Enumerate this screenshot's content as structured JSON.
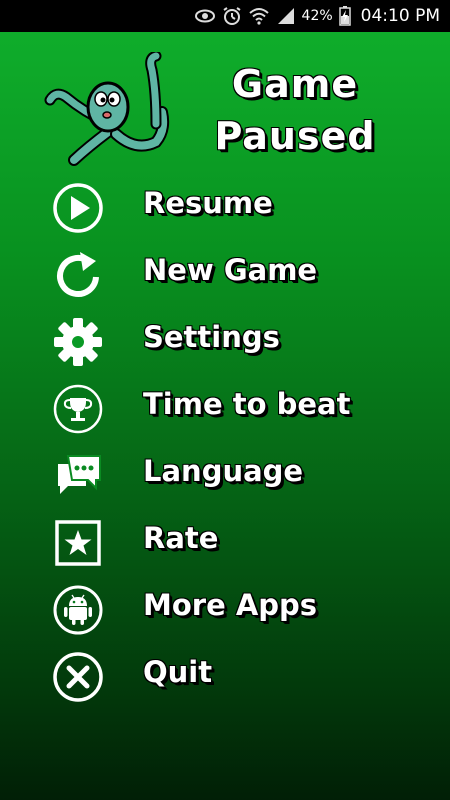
{
  "status_bar": {
    "battery_percent": "42%",
    "time": "04:10 PM",
    "icons": [
      "eye-icon",
      "alarm-icon",
      "wifi-icon",
      "signal-icon",
      "battery-icon"
    ]
  },
  "header": {
    "title_line1": "Game",
    "title_line2": "Paused",
    "mascot": "octopus-mascot"
  },
  "menu": {
    "items": [
      {
        "label": "Resume",
        "icon": "play-icon"
      },
      {
        "label": "New Game",
        "icon": "refresh-icon"
      },
      {
        "label": "Settings",
        "icon": "gear-icon"
      },
      {
        "label": "Time to beat",
        "icon": "trophy-icon"
      },
      {
        "label": "Language",
        "icon": "chat-icon"
      },
      {
        "label": "Rate",
        "icon": "star-icon"
      },
      {
        "label": "More Apps",
        "icon": "android-icon"
      },
      {
        "label": "Quit",
        "icon": "close-icon"
      }
    ]
  },
  "colors": {
    "background_top": "#0fad2b",
    "background_bottom": "#011f06",
    "text": "#ffffff",
    "text_outline": "#000000"
  }
}
